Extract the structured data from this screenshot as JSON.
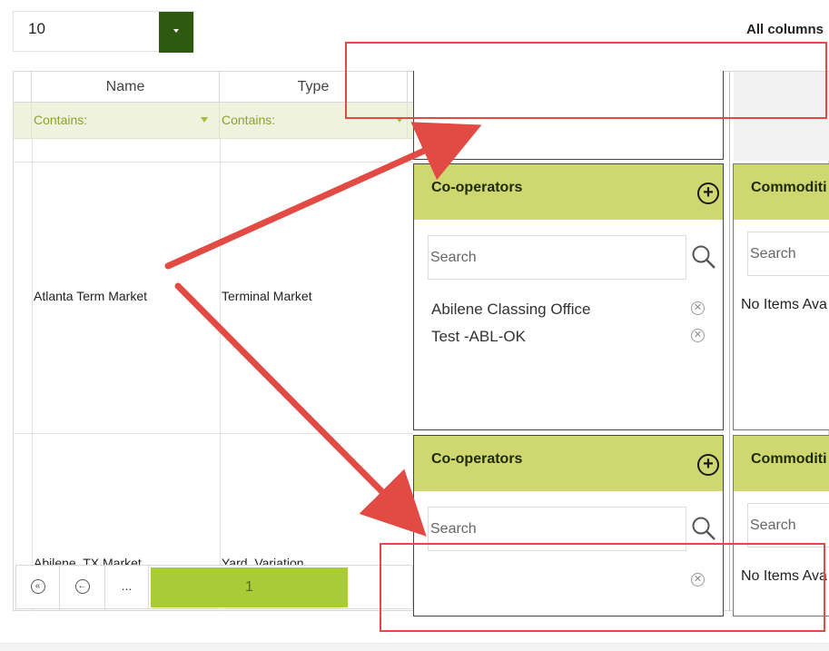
{
  "page_size": {
    "value": "10"
  },
  "all_columns_label": "All columns",
  "grid": {
    "headers": [
      "Name",
      "Type"
    ],
    "filter_labels": [
      "Contains:",
      "Contains:"
    ],
    "rows": [
      {
        "name": "Atlanta Term Market",
        "type": "Terminal Market"
      },
      {
        "name": "Abilene, TX Market",
        "type": "Yard, Variation"
      }
    ]
  },
  "panels": {
    "cooperators_title": "Co-operators",
    "commodities_title": "Commoditi",
    "search_placeholder": "Search",
    "row1_items": [
      "Abilene Classing Office",
      "Test -ABL-OK"
    ],
    "no_items_text": "No Items Ava"
  },
  "pager": {
    "first_icon": "double-chevron-left-icon",
    "prev_icon": "chevron-left-icon",
    "ellipsis": "...",
    "current_page": "1"
  },
  "colors": {
    "accent_green": "#2e5a10",
    "panel_header": "#cfd870",
    "page_active": "#a9cb35",
    "annotation_red": "#e24a44"
  }
}
